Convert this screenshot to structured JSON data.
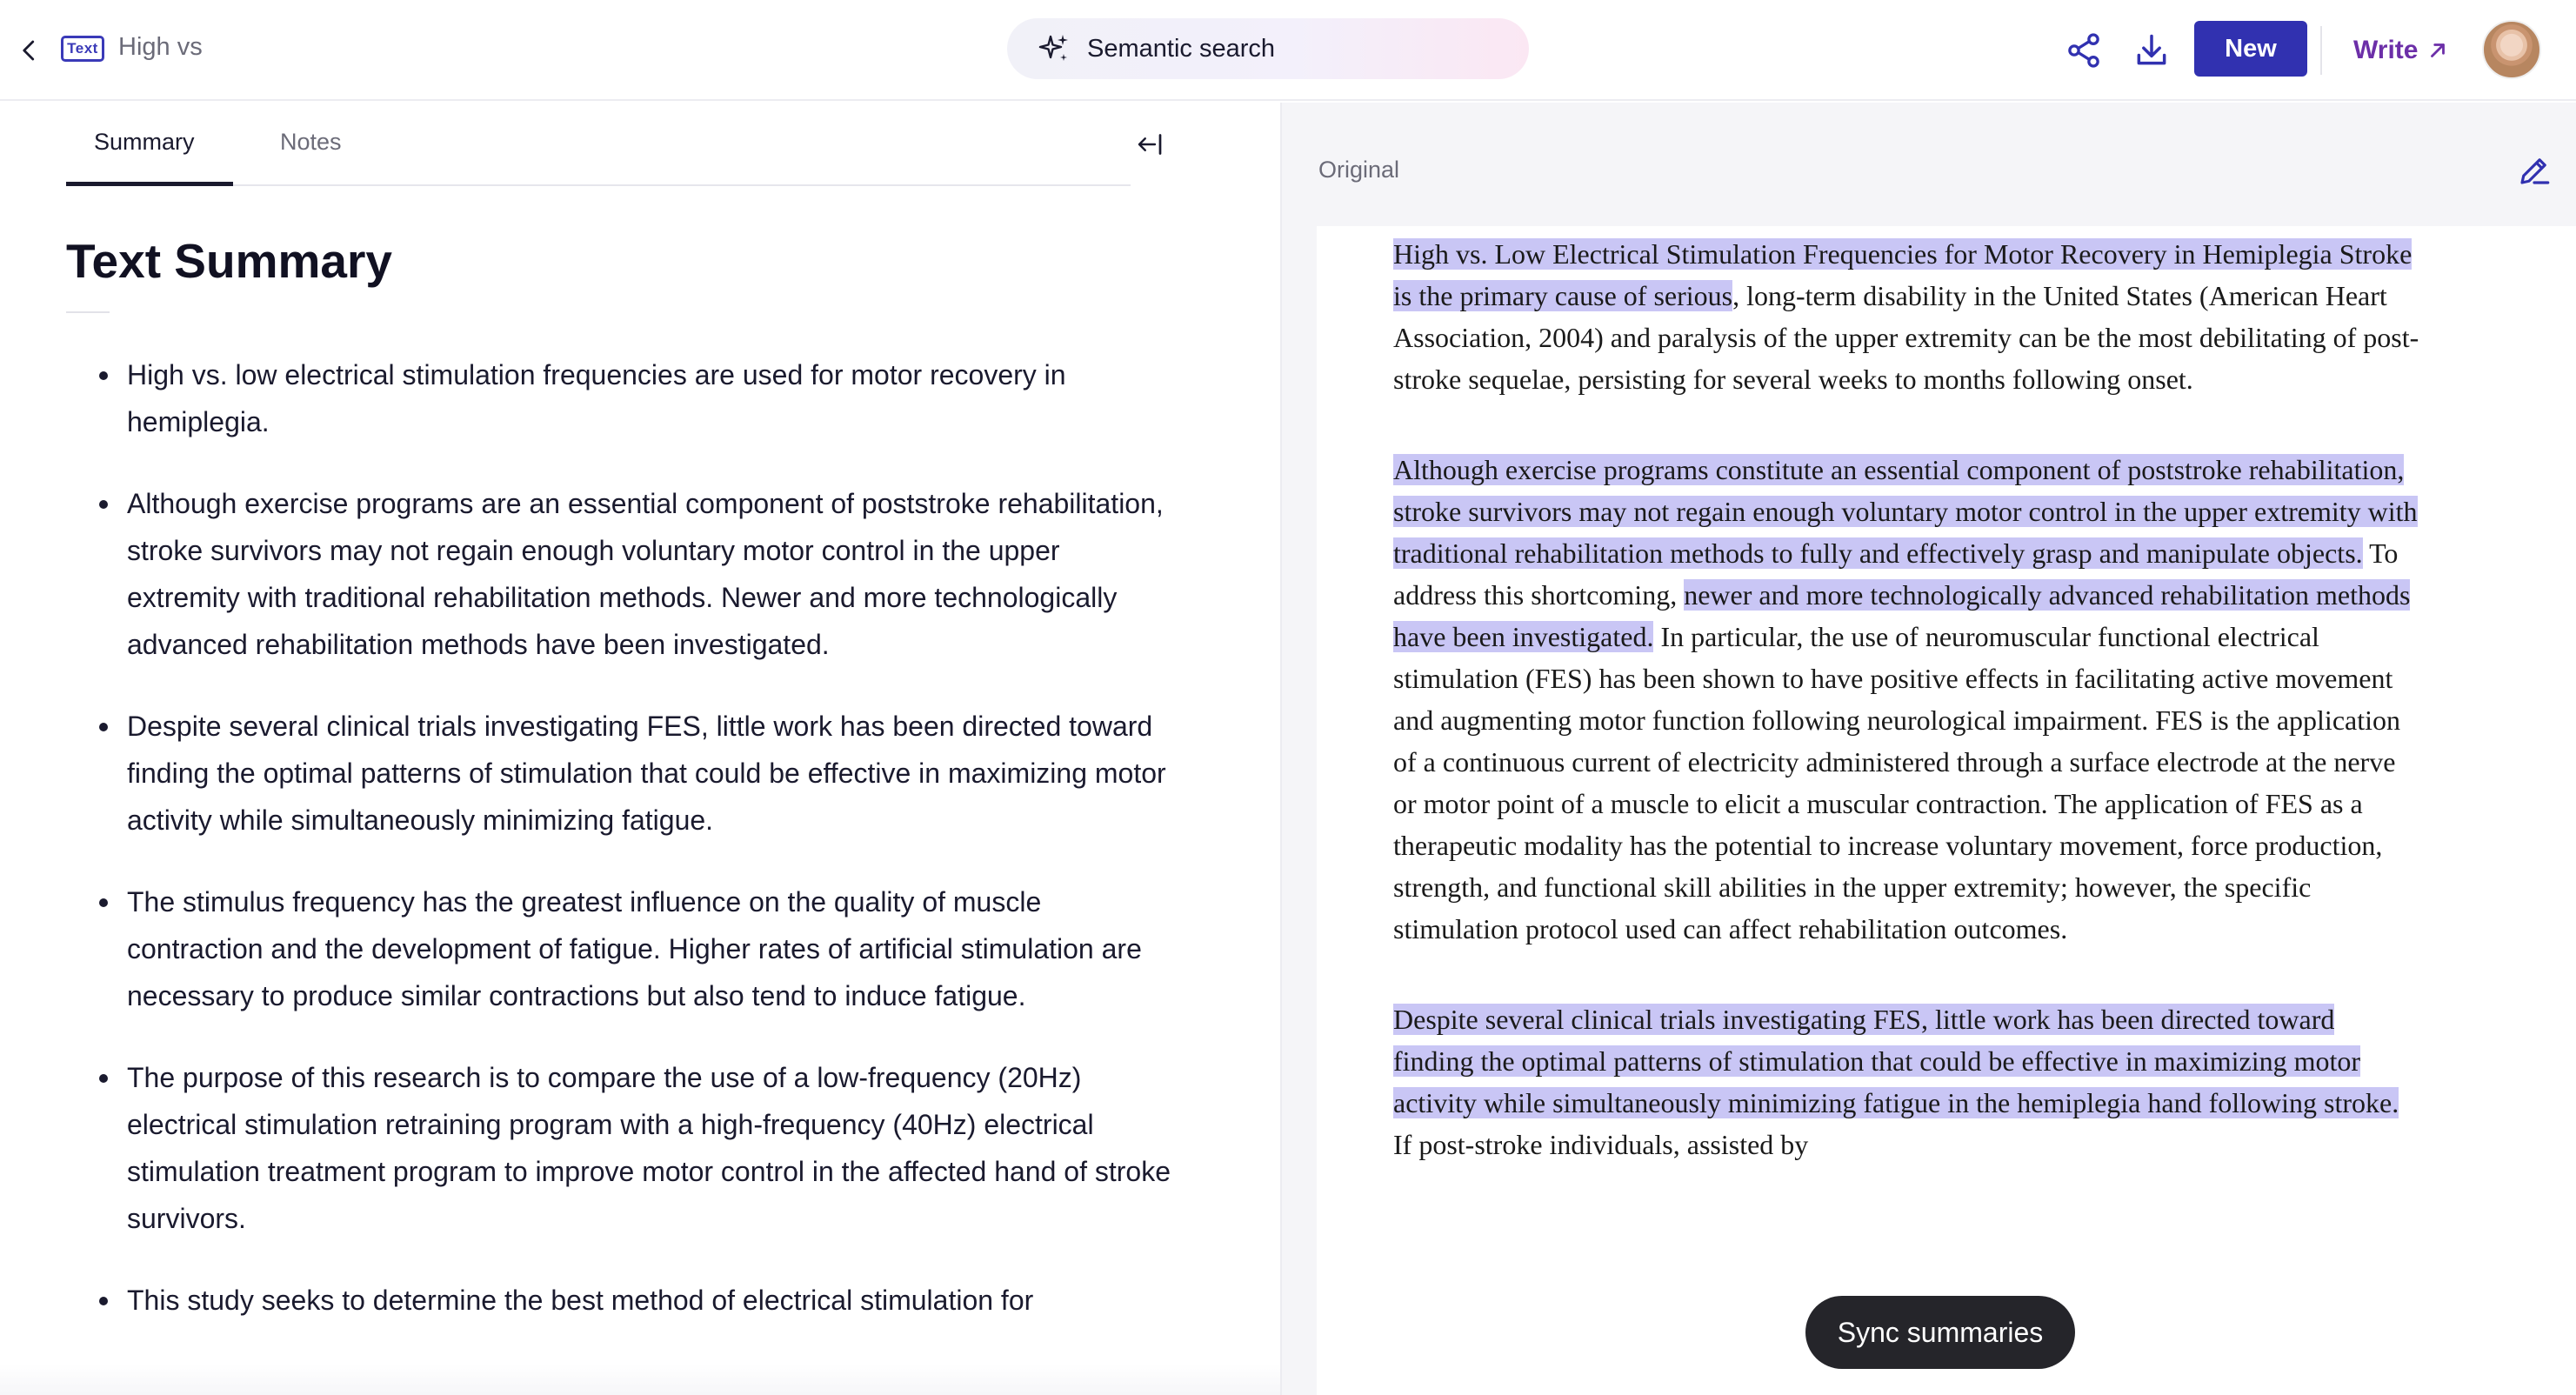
{
  "header": {
    "doc_type_badge": "Text",
    "doc_title": "High vs",
    "search_label": "Semantic search",
    "new_label": "New",
    "write_label": "Write"
  },
  "left": {
    "tabs": [
      {
        "label": "Summary",
        "active": true
      },
      {
        "label": "Notes",
        "active": false
      }
    ],
    "title": "Text Summary",
    "bullets": [
      "High vs. low electrical stimulation frequencies are used for motor recovery in hemiplegia.",
      "Although exercise programs are an essential component of poststroke rehabilitation, stroke survivors may not regain enough voluntary motor control in the upper extremity with traditional rehabilitation methods. Newer and more technologically advanced rehabilitation methods have been investigated.",
      "Despite several clinical trials investigating FES, little work has been directed toward finding the optimal patterns of stimulation that could be effective in maximizing motor activity while simultaneously minimizing fatigue.",
      "The stimulus frequency has the greatest influence on the quality of muscle contraction and the development of fatigue. Higher rates of artificial stimulation are necessary to produce similar contractions but also tend to induce fatigue.",
      "The purpose of this research is to compare the use of a low-frequency (20Hz) electrical stimulation retraining program with a high-frequency (40Hz) electrical stimulation treatment program to improve motor control in the affected hand of stroke survivors.",
      "This study seeks to determine the best method of electrical stimulation for"
    ]
  },
  "right": {
    "label": "Original",
    "paragraphs": [
      [
        {
          "text": "High vs. Low Electrical Stimulation Frequencies for Motor Recovery in Hemiplegia Stroke is the primary cause of serious",
          "hl": true
        },
        {
          "text": ", long-term disability in the United States (American Heart Association, 2004) and paralysis of the upper extremity can be the most debilitating of post-stroke sequelae, persisting for several weeks to months following onset.",
          "hl": false
        }
      ],
      [
        {
          "text": "Although exercise programs constitute an essential component of poststroke rehabilitation, stroke survivors may not regain enough voluntary motor control in the upper extremity with traditional rehabilitation methods to fully and effectively grasp and manipulate objects.",
          "hl": true
        },
        {
          "text": " To address this shortcoming, ",
          "hl": false
        },
        {
          "text": "newer and more technologically advanced rehabilitation methods have been investigated.",
          "hl": true
        },
        {
          "text": " In particular, the use of neuromuscular functional electrical stimulation (FES) has been shown to have positive effects in facilitating active movement and augmenting motor function following neurological impairment. FES is the application of a continuous current of electricity administered through a surface electrode at the nerve or motor point of a muscle to elicit a muscular contraction. The application of FES as a therapeutic modality has the potential to increase voluntary movement, force production, strength, and functional skill abilities in the upper extremity; however, the specific stimulation protocol used can affect rehabilitation outcomes.",
          "hl": false
        }
      ],
      [
        {
          "text": "Despite several clinical trials investigating FES, little work has been directed toward finding the optimal patterns of stimulation that could be effective in maximizing motor activity while simultaneously minimizing fatigue in the hemiplegia hand following stroke.",
          "hl": true
        },
        {
          "text": " If post-stroke individuals, assisted by",
          "hl": false
        }
      ]
    ]
  },
  "sync_label": "Sync summaries"
}
